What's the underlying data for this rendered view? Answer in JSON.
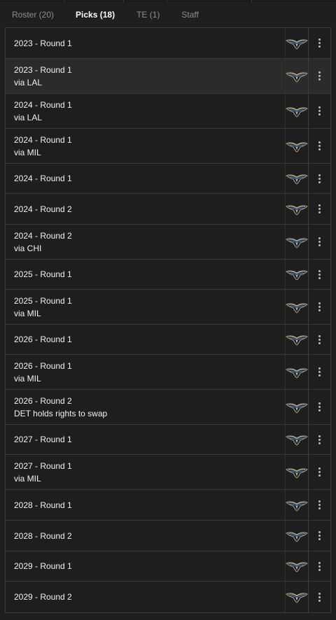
{
  "tabs": [
    {
      "label": "Roster (20)",
      "active": false
    },
    {
      "label": "Picks (18)",
      "active": true
    },
    {
      "label": "TE (1)",
      "active": false
    },
    {
      "label": "Staff",
      "active": false
    }
  ],
  "picks": [
    {
      "title": "2023 - Round 1",
      "sub": ""
    },
    {
      "title": "2023 - Round 1",
      "sub": "via LAL",
      "highlighted": true
    },
    {
      "title": "2024 - Round 1",
      "sub": "via LAL"
    },
    {
      "title": "2024 - Round 1",
      "sub": "via MIL"
    },
    {
      "title": "2024 - Round 1",
      "sub": ""
    },
    {
      "title": "2024 - Round 2",
      "sub": ""
    },
    {
      "title": "2024 - Round 2",
      "sub": "via CHI"
    },
    {
      "title": "2025 - Round 1",
      "sub": ""
    },
    {
      "title": "2025 - Round 1",
      "sub": "via MIL"
    },
    {
      "title": "2026 - Round 1",
      "sub": ""
    },
    {
      "title": "2026 - Round 1",
      "sub": "via MIL"
    },
    {
      "title": "2026 - Round 2",
      "sub": "DET holds rights to swap"
    },
    {
      "title": "2027 - Round 1",
      "sub": ""
    },
    {
      "title": "2027 - Round 1",
      "sub": "via MIL"
    },
    {
      "title": "2028 - Round 1",
      "sub": ""
    },
    {
      "title": "2028 - Round 2",
      "sub": ""
    },
    {
      "title": "2029 - Round 1",
      "sub": ""
    },
    {
      "title": "2029 - Round 2",
      "sub": ""
    }
  ],
  "icons": {
    "team_logo": "pelicans-logo-icon",
    "row_menu": "more-vertical-icon"
  },
  "colors": {
    "background": "#1f1f1f",
    "row_highlight": "#2b2b2b",
    "active_tab": "#ffffff",
    "inactive_tab": "#8d8d8d",
    "logo_navy": "#0c2340",
    "logo_gold": "#c8a96b"
  }
}
